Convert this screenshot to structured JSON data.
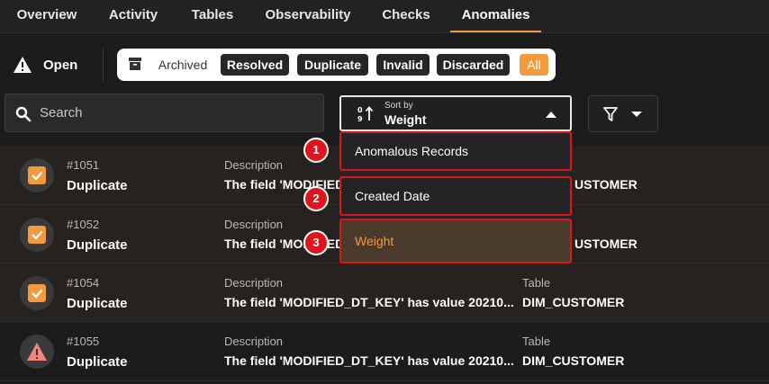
{
  "tabs": [
    "Overview",
    "Activity",
    "Tables",
    "Observability",
    "Checks",
    "Anomalies"
  ],
  "status": {
    "open": "Open",
    "archived": "Archived",
    "resolved": "Resolved",
    "duplicate": "Duplicate",
    "invalid": "Invalid",
    "discarded": "Discarded",
    "all": "All"
  },
  "search": {
    "placeholder": "Search"
  },
  "sort": {
    "label": "Sort by",
    "value": "Weight"
  },
  "dropdown": {
    "options": [
      "Anomalous Records",
      "Created Date",
      "Weight"
    ],
    "badges": [
      "1",
      "2",
      "3"
    ]
  },
  "rows": [
    {
      "id": "#1051",
      "type": "Duplicate",
      "desc_label": "Description",
      "desc": "The field 'MODIFIED_",
      "table_label": "",
      "table": "USTOMER"
    },
    {
      "id": "#1052",
      "type": "Duplicate",
      "desc_label": "Description",
      "desc": "The field 'MODIFIED_",
      "table_label": "",
      "table": "USTOMER"
    },
    {
      "id": "#1054",
      "type": "Duplicate",
      "desc_label": "Description",
      "desc": "The field 'MODIFIED_DT_KEY' has value 20210...",
      "table_label": "Table",
      "table": "DIM_CUSTOMER"
    },
    {
      "id": "#1055",
      "type": "Duplicate",
      "desc_label": "Description",
      "desc": "The field 'MODIFIED_DT_KEY' has value 20210...",
      "table_label": "Table",
      "table": "DIM_CUSTOMER"
    }
  ],
  "colors": {
    "accent": "#f19a3e",
    "highlight": "#e0141e",
    "background": "#1c1c1e"
  }
}
